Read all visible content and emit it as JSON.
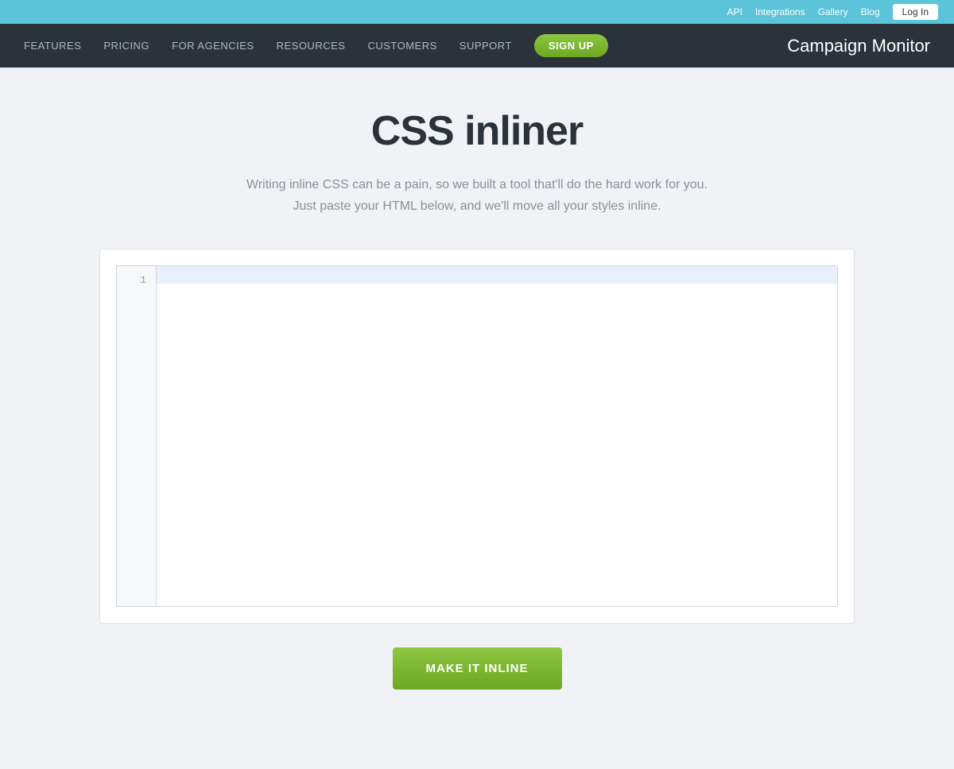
{
  "topBar": {
    "links": [
      {
        "id": "api",
        "label": "API"
      },
      {
        "id": "integrations",
        "label": "Integrations"
      },
      {
        "id": "gallery",
        "label": "Gallery"
      },
      {
        "id": "blog",
        "label": "Blog"
      }
    ],
    "loginLabel": "Log In"
  },
  "mainNav": {
    "links": [
      {
        "id": "features",
        "label": "FEATURES"
      },
      {
        "id": "pricing",
        "label": "PRICING"
      },
      {
        "id": "for-agencies",
        "label": "FOR AGENCIES"
      },
      {
        "id": "resources",
        "label": "RESOURCES"
      },
      {
        "id": "customers",
        "label": "CUSTOMERS"
      },
      {
        "id": "support",
        "label": "SUPPORT"
      }
    ],
    "signupLabel": "SIGN UP",
    "brandName": "Campaign Monitor"
  },
  "hero": {
    "title": "CSS inliner",
    "subtitle1": "Writing inline CSS can be a pain, so we built a tool that'll do the hard work for you.",
    "subtitle2": "Just paste your HTML below, and we'll move all your styles inline."
  },
  "editor": {
    "lineNumber": "1",
    "placeholder": ""
  },
  "cta": {
    "buttonLabel": "MAKE IT INLINE"
  }
}
